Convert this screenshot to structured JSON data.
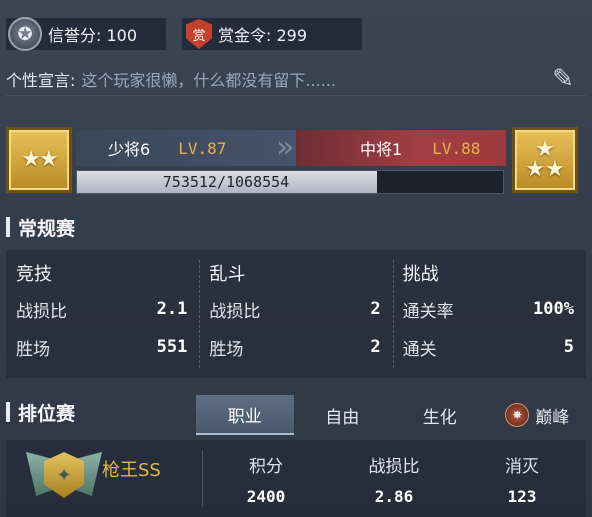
{
  "profile": {
    "credit_label": "信誉分: 100",
    "bounty_label": "赏金令: 299",
    "credit_icon": "laurel-badge-icon",
    "bounty_icon": "red-shield-bounty-icon",
    "bounty_icon_text": "赏",
    "signature_label": "个性宣言:",
    "signature_text": "这个玩家很懒，什么都没有留下......"
  },
  "rank": {
    "current_name": "少将6",
    "current_level": "LV.87",
    "next_name": "中将1",
    "next_level": "LV.88",
    "xp_text": "753512/1068554",
    "xp_current": 753512,
    "xp_total": 1068554,
    "current_badge": "★★",
    "next_badge_top": "★",
    "next_badge_bottom": "★★",
    "chevron": "»",
    "colors": {
      "level": "#e3b24a",
      "next_bar": "#a33f44"
    }
  },
  "regular": {
    "title": "常规赛",
    "columns": [
      {
        "head": "竞技",
        "rows": [
          {
            "k": "战损比",
            "v": "2.1"
          },
          {
            "k": "胜场",
            "v": "551"
          }
        ]
      },
      {
        "head": "乱斗",
        "rows": [
          {
            "k": "战损比",
            "v": "2"
          },
          {
            "k": "胜场",
            "v": "2"
          }
        ]
      },
      {
        "head": "挑战",
        "rows": [
          {
            "k": "通关率",
            "v": "100%"
          },
          {
            "k": "通关",
            "v": "5"
          }
        ]
      }
    ]
  },
  "ranked": {
    "title": "排位赛",
    "tabs": [
      "职业",
      "自由",
      "生化",
      "巅峰"
    ],
    "active_tab": 0,
    "rank_name": "枪王SS",
    "emblem_text": "✦",
    "stats": [
      {
        "k": "积分",
        "v": "2400"
      },
      {
        "k": "战损比",
        "v": "2.86"
      },
      {
        "k": "消灭",
        "v": "123"
      }
    ]
  }
}
